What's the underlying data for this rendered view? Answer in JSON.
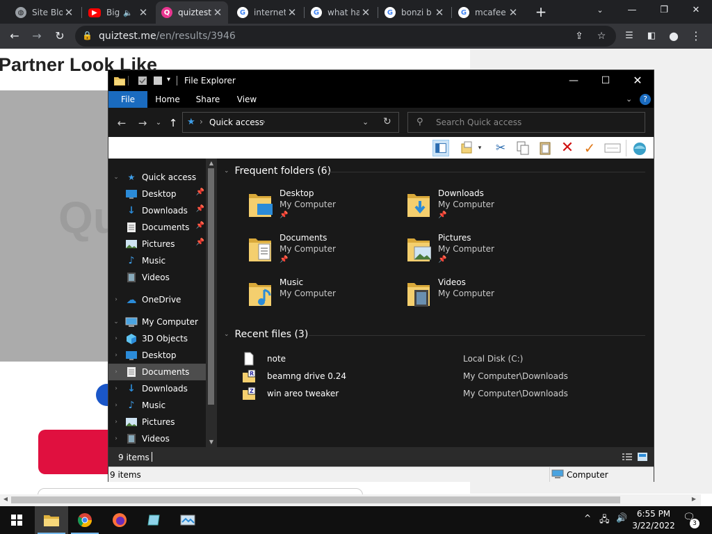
{
  "browser": {
    "tabs": [
      {
        "title": "Site Blo",
        "favicon": "globe-icon"
      },
      {
        "title": "Big",
        "favicon": "youtube-icon",
        "audio": true
      },
      {
        "title": "quiztest",
        "favicon": "quiztest-icon"
      },
      {
        "title": "internet",
        "favicon": "google-icon"
      },
      {
        "title": "what ha",
        "favicon": "google-icon"
      },
      {
        "title": "bonzi b",
        "favicon": "google-icon"
      },
      {
        "title": "mcafee",
        "favicon": "google-icon"
      }
    ],
    "address": {
      "host": "quiztest.me",
      "path": "/en/results/3946"
    },
    "accent": "#35363a"
  },
  "webpage": {
    "heading": "Partner Look Like",
    "logo_fragment": "Qu"
  },
  "explorer": {
    "title": "File Explorer",
    "ribbon_tabs": [
      "File",
      "Home",
      "Share",
      "View"
    ],
    "breadcrumb": "Quick access",
    "search_placeholder": "Search Quick access",
    "nav": [
      {
        "label": "Quick access",
        "icon": "star-icon",
        "level": 0,
        "expanded": true
      },
      {
        "label": "Desktop",
        "icon": "desktop-icon",
        "level": 1,
        "pinned": true
      },
      {
        "label": "Downloads",
        "icon": "downloads-icon",
        "level": 1,
        "pinned": true
      },
      {
        "label": "Documents",
        "icon": "documents-icon",
        "level": 1,
        "pinned": true
      },
      {
        "label": "Pictures",
        "icon": "pictures-icon",
        "level": 1,
        "pinned": true
      },
      {
        "label": "Music",
        "icon": "music-icon",
        "level": 1
      },
      {
        "label": "Videos",
        "icon": "videos-icon",
        "level": 1
      },
      {
        "label": "OneDrive",
        "icon": "cloud-icon",
        "level": 0
      },
      {
        "label": "My Computer",
        "icon": "computer-icon",
        "level": 0,
        "expanded": true
      },
      {
        "label": "3D Objects",
        "icon": "cube-icon",
        "level": 1
      },
      {
        "label": "Desktop",
        "icon": "desktop-icon",
        "level": 1
      },
      {
        "label": "Documents",
        "icon": "documents-icon",
        "level": 1,
        "selected": true
      },
      {
        "label": "Downloads",
        "icon": "downloads-icon",
        "level": 1
      },
      {
        "label": "Music",
        "icon": "music-icon",
        "level": 1
      },
      {
        "label": "Pictures",
        "icon": "pictures-icon",
        "level": 1
      },
      {
        "label": "Videos",
        "icon": "videos-icon",
        "level": 1
      }
    ],
    "frequent_header": "Frequent folders (6)",
    "frequent": [
      {
        "name": "Desktop",
        "location": "My Computer",
        "pinned": true
      },
      {
        "name": "Downloads",
        "location": "My Computer",
        "pinned": true
      },
      {
        "name": "Documents",
        "location": "My Computer",
        "pinned": true
      },
      {
        "name": "Pictures",
        "location": "My Computer",
        "pinned": true
      },
      {
        "name": "Music",
        "location": "My Computer"
      },
      {
        "name": "Videos",
        "location": "My Computer"
      }
    ],
    "recent_header": "Recent files (3)",
    "recent": [
      {
        "name": "note",
        "path": "Local Disk (C:)",
        "icon": "text-file-icon"
      },
      {
        "name": "beamng drive 0.24",
        "path": "My Computer\\Downloads",
        "icon": "archive-icon"
      },
      {
        "name": "win areo tweaker",
        "path": "My Computer\\Downloads",
        "icon": "archive-icon"
      }
    ],
    "status_count": "9 items",
    "status_count_classic": "9 items",
    "status_zone": "Computer"
  },
  "taskbar": {
    "time": "6:55 PM",
    "date": "3/22/2022",
    "notification_count": "3"
  }
}
